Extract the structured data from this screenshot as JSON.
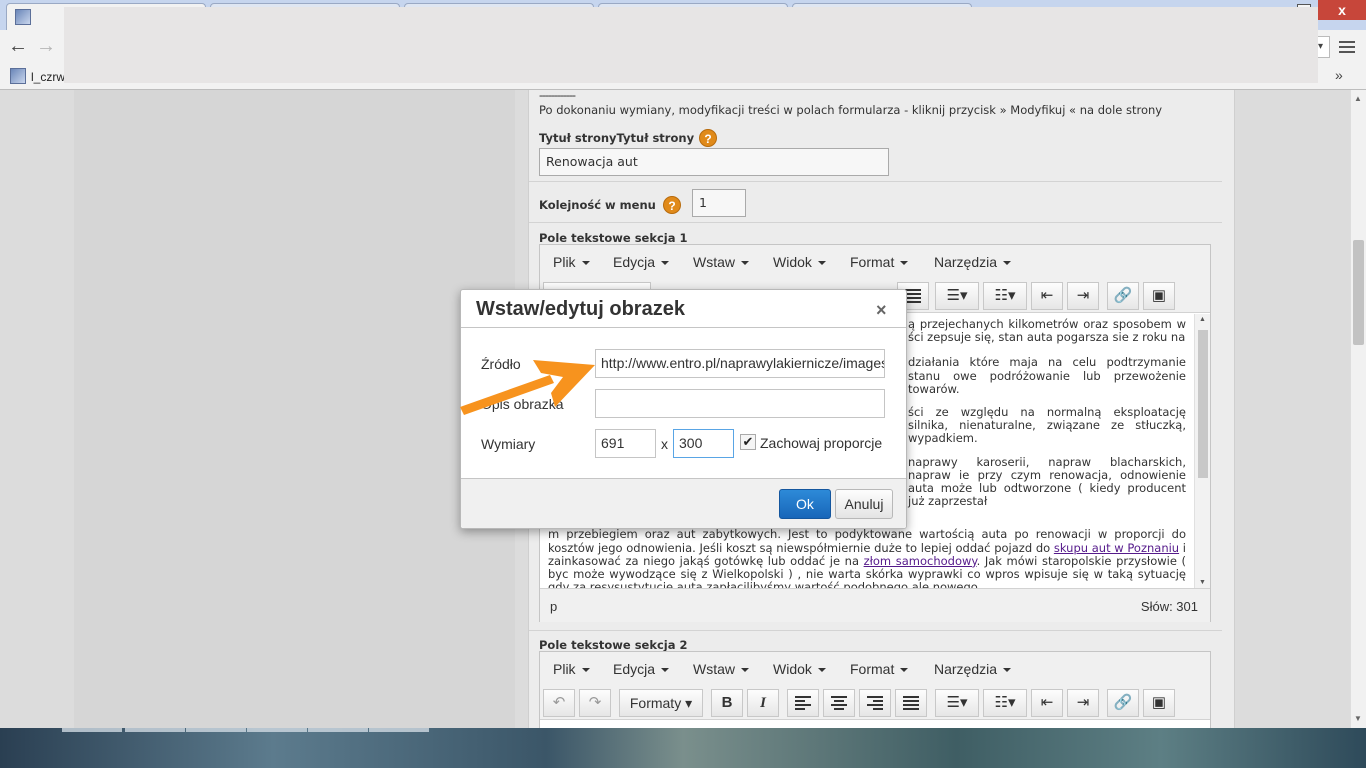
{
  "browser": {
    "tab_title": "I",
    "bookmark_label": "l_czrw",
    "more_bookmarks": "»",
    "window_close": "x"
  },
  "form": {
    "dashes": "------------",
    "info_text": "Po dokonaniu wymiany, modyfikacji treści w polach formularza - kliknij przycisk » Modyfikuj « na dole strony",
    "page_title_label": "Tytuł stronyTytuł strony",
    "page_title_value": "Renowacja aut",
    "menu_order_label": "Kolejność w menu",
    "menu_order_value": "1",
    "help_glyph": "?",
    "section1_label": "Pole tekstowe sekcja 1",
    "section2_label": "Pole tekstowe sekcja 2"
  },
  "editor": {
    "menus": [
      "Plik",
      "Edycja",
      "Wstaw",
      "Widok",
      "Format",
      "Narzędzia"
    ],
    "formats_label": "Formaty",
    "bold": "B",
    "italic": "I",
    "status_path": "p",
    "word_count": "Słów: 301",
    "paragraphs": [
      "ą przejechanych kilkometrów oraz sposobem w ści zepsuje się, stan auta pogarsza sie z roku na",
      "działania które maja na celu podtrzymanie stanu owe podróżowanie lub przewożenie towarów.",
      "ści ze względu na normalną eksploatację silnika, nienaturalne, związane ze stłuczką, wypadkiem.",
      "naprawy karoserii, napraw blacharskich, napraw ie przy czym renowacja, odnowienie auta może lub odtworzone ( kiedy producent już zaprzestał",
      "m przebiegiem oraz aut zabytkowych. Jest to podyktowane wartością auta po renowacji w proporcji do kosztów jego odnowienia. Jeśli koszt są niewspółmiernie duże to lepiej oddać pojazd do"
    ],
    "link1": "skupu aut w Poznaniu",
    "after_link1": " i zainkasować za niego jakąś gotówkę lub oddać je na ",
    "link2": "złom samochodowy",
    "after_link2": ". Jak mówi staropolskie przysłowie ( byc może wywodzące się z Wielkopolski ) , nie warta skórka wyprawki co wpros wpisuje się w taką sytuację gdy za resysustytucję auta zapłacilibyśmy wartość podobnego ale nowego."
  },
  "dialog": {
    "title": "Wstaw/edytuj obrazek",
    "close": "×",
    "source_label": "Źródło",
    "source_value": "http://www.entro.pl/naprawylakiernicze/images/",
    "description_label": "Opis obrazka",
    "description_value": "",
    "dimensions_label": "Wymiary",
    "width_value": "691",
    "times": "x",
    "height_value": "300",
    "keep_ratio_label": "Zachowaj proporcje",
    "keep_ratio_checked": "✔",
    "ok_label": "Ok",
    "cancel_label": "Anuluj"
  },
  "colors": {
    "accent_orange": "#f7931e",
    "ok_blue": "#1866b9"
  }
}
